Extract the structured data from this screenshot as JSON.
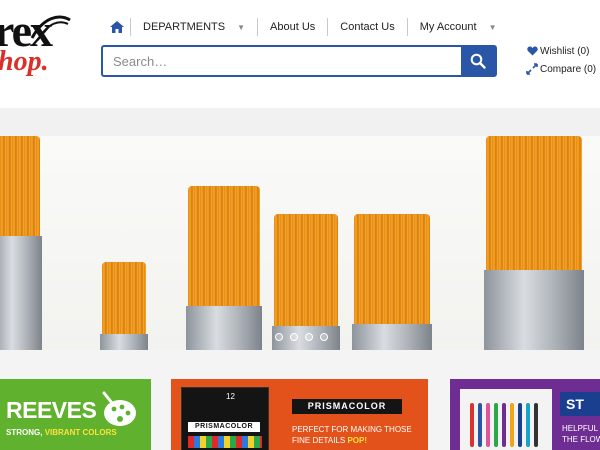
{
  "brand": {
    "logo_top": "rex",
    "logo_bottom": "hop."
  },
  "nav": {
    "home_icon": "home-icon",
    "items": [
      {
        "label": "DEPARTMENTS",
        "has_caret": true
      },
      {
        "label": "About Us",
        "has_caret": false
      },
      {
        "label": "Contact Us",
        "has_caret": false
      },
      {
        "label": "My Account",
        "has_caret": true
      }
    ],
    "caret_glyph": "▼"
  },
  "search": {
    "placeholder": "Search…",
    "value": "",
    "icon": "search-icon"
  },
  "utility": {
    "wishlist": "Wishlist (0)",
    "compare": "Compare (0)"
  },
  "slider": {
    "total_slides": 4,
    "active_index": 0
  },
  "promos": {
    "reeves": {
      "title": "REEVES",
      "tag_white": "STRONG,",
      "tag_yellow": "VIBRANT COLORS"
    },
    "prismacolor": {
      "box_number": "12",
      "box_name": "PRISMACOLOR",
      "name": "PRISMACOLOR",
      "tag_line1": "PERFECT FOR MAKING THOSE",
      "tag_line2": "FINE DETAILS",
      "tag_pop": "POP!"
    },
    "staedtler": {
      "brand": "ST",
      "tag_line1": "HELPFUL T",
      "tag_line2": "THE FLOW"
    }
  },
  "colors": {
    "primary_blue": "#2a56a8",
    "logo_red": "#d9302a",
    "reeves_green": "#5fb12e",
    "prisma_orange": "#e4521c",
    "staedtler_purple": "#6e2d93"
  }
}
